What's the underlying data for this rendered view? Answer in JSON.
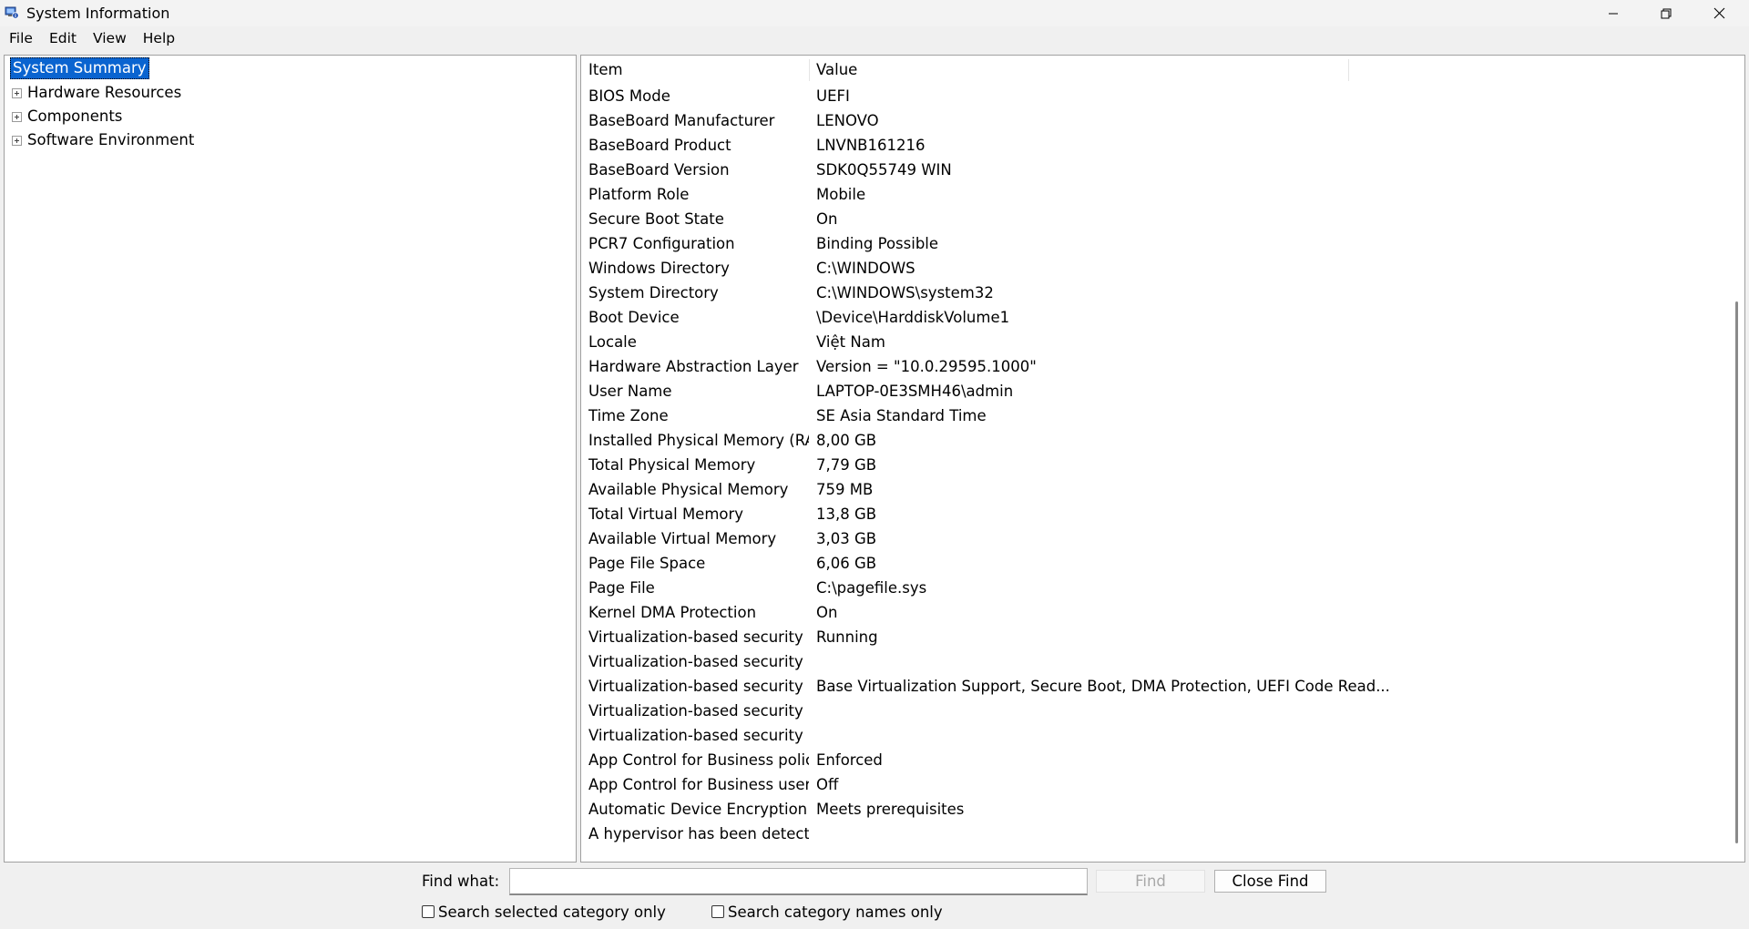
{
  "window": {
    "title": "System Information",
    "icon": "system-info-icon"
  },
  "menu": [
    "File",
    "Edit",
    "View",
    "Help"
  ],
  "tree": {
    "selected": "System Summary",
    "items": [
      "Hardware Resources",
      "Components",
      "Software Environment"
    ]
  },
  "list": {
    "columns": [
      "Item",
      "Value"
    ],
    "rows": [
      {
        "item": "BIOS Mode",
        "value": "UEFI"
      },
      {
        "item": "BaseBoard Manufacturer",
        "value": "LENOVO"
      },
      {
        "item": "BaseBoard Product",
        "value": "LNVNB161216"
      },
      {
        "item": "BaseBoard Version",
        "value": "SDK0Q55749 WIN"
      },
      {
        "item": "Platform Role",
        "value": "Mobile"
      },
      {
        "item": "Secure Boot State",
        "value": "On"
      },
      {
        "item": "PCR7 Configuration",
        "value": "Binding Possible"
      },
      {
        "item": "Windows Directory",
        "value": "C:\\WINDOWS"
      },
      {
        "item": "System Directory",
        "value": "C:\\WINDOWS\\system32"
      },
      {
        "item": "Boot Device",
        "value": "\\Device\\HarddiskVolume1"
      },
      {
        "item": "Locale",
        "value": "Việt Nam"
      },
      {
        "item": "Hardware Abstraction Layer",
        "value": "Version = \"10.0.29595.1000\""
      },
      {
        "item": "User Name",
        "value": "LAPTOP-0E3SMH46\\admin"
      },
      {
        "item": "Time Zone",
        "value": "SE Asia Standard Time"
      },
      {
        "item": "Installed Physical Memory (RA...",
        "value": "8,00 GB"
      },
      {
        "item": "Total Physical Memory",
        "value": "7,79 GB"
      },
      {
        "item": "Available Physical Memory",
        "value": "759 MB"
      },
      {
        "item": "Total Virtual Memory",
        "value": "13,8 GB"
      },
      {
        "item": "Available Virtual Memory",
        "value": "3,03 GB"
      },
      {
        "item": "Page File Space",
        "value": "6,06 GB"
      },
      {
        "item": "Page File",
        "value": "C:\\pagefile.sys"
      },
      {
        "item": "Kernel DMA Protection",
        "value": "On"
      },
      {
        "item": "Virtualization-based security",
        "value": "Running"
      },
      {
        "item": "Virtualization-based security ...",
        "value": ""
      },
      {
        "item": "Virtualization-based security ...",
        "value": "Base Virtualization Support, Secure Boot, DMA Protection, UEFI Code Read..."
      },
      {
        "item": "Virtualization-based security S...",
        "value": ""
      },
      {
        "item": "Virtualization-based security S...",
        "value": ""
      },
      {
        "item": "App Control for Business policy",
        "value": "Enforced"
      },
      {
        "item": "App Control for Business user ...",
        "value": "Off"
      },
      {
        "item": "Automatic Device Encryption ...",
        "value": "Meets prerequisites"
      },
      {
        "item": "A hypervisor has been detecte...",
        "value": ""
      }
    ]
  },
  "find": {
    "label": "Find what:",
    "value": "",
    "find_button": "Find",
    "close_button": "Close Find",
    "check_selected": "Search selected category only",
    "check_names": "Search category names only"
  },
  "colors": {
    "selection": "#0a64d0",
    "window_bg": "#f0f0f0",
    "pane_bg": "#ffffff"
  }
}
